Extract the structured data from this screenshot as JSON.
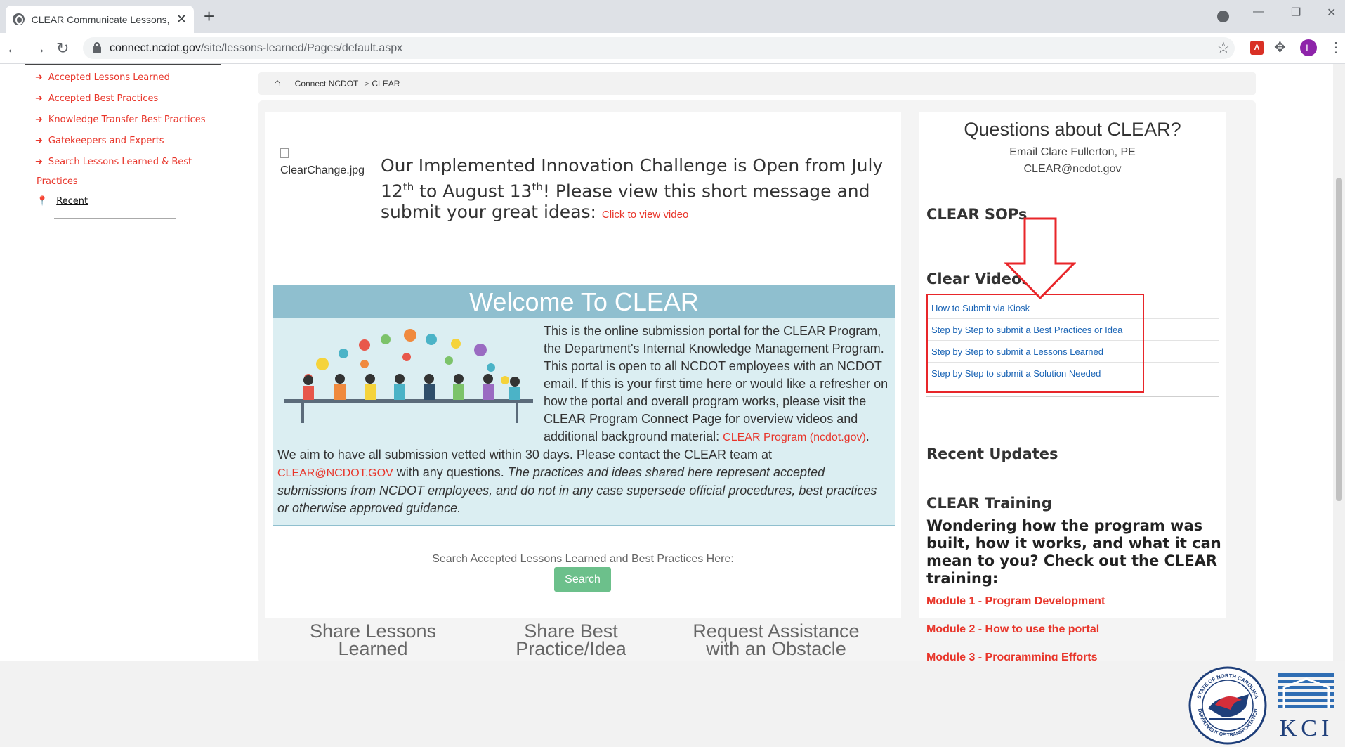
{
  "browser": {
    "tab_title": "CLEAR Communicate Lessons, Ex",
    "tab_close": "✕",
    "new_tab": "+",
    "url_host": "connect.ncdot.gov",
    "url_path": "/site/lessons-learned/Pages/default.aspx",
    "avatar_letter": "L",
    "pdf_ext": "A",
    "win_min": "—",
    "win_restore": "❐",
    "win_close": "✕"
  },
  "leftnav": {
    "items": [
      "Accepted Lessons Learned",
      "Accepted Best Practices",
      "Knowledge Transfer Best Practices",
      "Gatekeepers and Experts",
      "Search Lessons Learned & Best"
    ],
    "item5_cont": "Practices",
    "recent": "Recent"
  },
  "breadcrumb": {
    "root": "Connect NCDOT",
    "sep": ">",
    "current": "CLEAR"
  },
  "announcement": {
    "img_alt": "ClearChange.jpg",
    "text_1": "Our Implemented Innovation Challenge is Open from July 12",
    "sup_1": "th",
    "text_2": " to August 13",
    "sup_2": "th",
    "text_3": "! Please view this short message and submit your great ideas: ",
    "link": "Click to view video"
  },
  "welcome": {
    "title": "Welcome To CLEAR",
    "body_1": "This is the online submission portal for the CLEAR Program, the Department's Internal Knowledge Management Program. This portal is open to all NCDOT employees with an NCDOT email. If this is your first time here or would like a refresher on how the portal and overall program works, please visit the CLEAR Program Connect Page for overview videos and additional background material: ",
    "link_1": "CLEAR Program (ncdot.gov)",
    "body_2": ". We aim to have all submission vetted within 30 days. Please contact the CLEAR team at ",
    "link_2": "CLEAR@NCDOT.GOV",
    "body_3": " with any questions. ",
    "italic": "The practices and ideas shared here represent accepted submissions from NCDOT employees, and do not in any case supersede official procedures, best practices or otherwise approved guidance."
  },
  "search": {
    "label": "Search Accepted Lessons Learned and Best Practices Here:",
    "button": "Search"
  },
  "share": {
    "lessons_1": "Share Lessons",
    "lessons_2": "Learned",
    "best_1": "Share Best",
    "best_2": "Practice/Idea",
    "assist_1": "Request Assistance",
    "assist_2": "with an Obstacle"
  },
  "right": {
    "q_title": "Questions about CLEAR?",
    "q_email_name": "Email Clare Fullerton, PE",
    "q_email": "CLEAR@ncdot.gov",
    "sops": "CLEAR SOPs",
    "videos": "Clear Videos",
    "video_links": [
      "How to Submit via Kiosk",
      "Step by Step to submit a Best Practices or Idea",
      "Step by Step to submit a Lessons Learned",
      "Step by Step to submit a Solution Needed"
    ],
    "recent_updates": "Recent Updates",
    "training": "CLEAR Training",
    "wonder": "Wondering how the program was built, how it works, and what it can mean to you? Check out the CLEAR training:",
    "modules": [
      "Module 1 - Program Development",
      "Module 2 - How to use the portal",
      "Module 3 - Programming Efforts"
    ]
  },
  "logos": {
    "dot_top": "STATE OF NORTH CAROLINA",
    "dot_bottom": "DEPARTMENT OF TRANSPORTATION",
    "kci": "KCI"
  },
  "colors": {
    "link_red": "#e8352a",
    "link_blue": "#1a64b5",
    "welcome_header": "#8fbfcf",
    "welcome_bg": "#dbeef2",
    "search_green": "#6cc08b",
    "annotation_red": "#e8262a"
  }
}
